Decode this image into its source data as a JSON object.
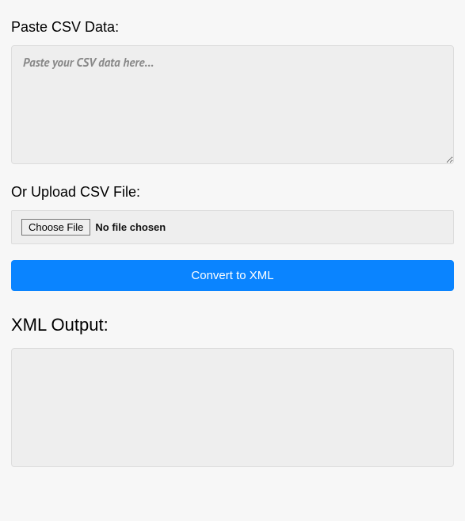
{
  "pasteSection": {
    "label": "Paste CSV Data:",
    "placeholder": "Paste your CSV data here...",
    "value": ""
  },
  "uploadSection": {
    "label": "Or Upload CSV File:",
    "chooseFileLabel": "Choose File",
    "fileStatus": "No file chosen"
  },
  "convertButton": {
    "label": "Convert to XML"
  },
  "outputSection": {
    "label": "XML Output:",
    "content": ""
  }
}
